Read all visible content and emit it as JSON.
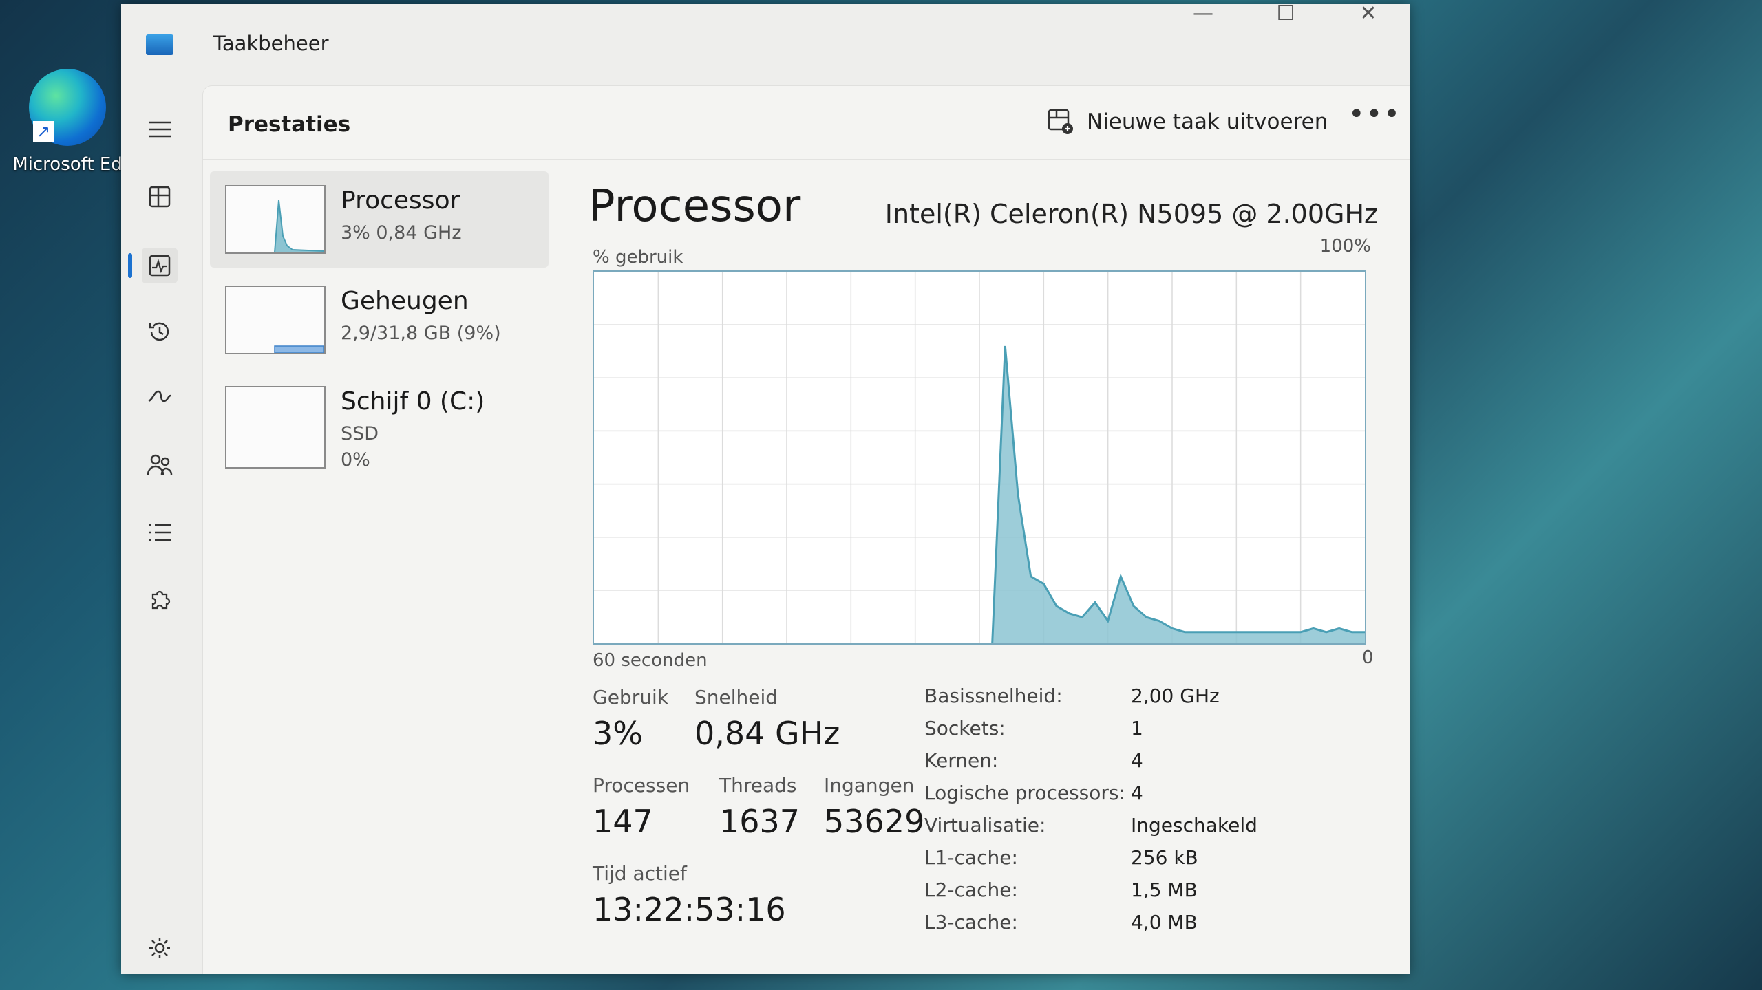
{
  "desktop": {
    "shortcut_label": "Microsoft Ed"
  },
  "window": {
    "title": "Taakbeheer",
    "controls": {
      "minimize": "—",
      "maximize": "☐",
      "close": "✕"
    }
  },
  "header": {
    "title": "Prestaties",
    "new_task_label": "Nieuwe taak uitvoeren",
    "more_label": "•••"
  },
  "sidebar": {
    "items": [
      {
        "name": "Processor",
        "sub": "3% 0,84 GHz"
      },
      {
        "name": "Geheugen",
        "sub": "2,9/31,8 GB (9%)"
      },
      {
        "name": "Schijf 0 (C:)",
        "sub": "SSD",
        "sub2": "0%"
      }
    ]
  },
  "main": {
    "title": "Processor",
    "cpu_model": "Intel(R) Celeron(R) N5095 @ 2.00GHz",
    "usage_axis_label": "% gebruik",
    "axis_max_label": "100%",
    "axis_time_label": "60 seconden",
    "axis_min_label": "0",
    "stats": {
      "usage_label": "Gebruik",
      "usage_value": "3%",
      "speed_label": "Snelheid",
      "speed_value": "0,84 GHz",
      "processes_label": "Processen",
      "processes_value": "147",
      "threads_label": "Threads",
      "threads_value": "1637",
      "handles_label": "Ingangen",
      "handles_value": "53629",
      "uptime_label": "Tijd actief",
      "uptime_value": "13:22:53:16"
    },
    "specs": [
      {
        "k": "Basissnelheid:",
        "v": "2,00 GHz"
      },
      {
        "k": "Sockets:",
        "v": "1"
      },
      {
        "k": "Kernen:",
        "v": "4"
      },
      {
        "k": "Logische processors:",
        "v": "4"
      },
      {
        "k": "Virtualisatie:",
        "v": "Ingeschakeld"
      },
      {
        "k": "L1-cache:",
        "v": "256 kB"
      },
      {
        "k": "L2-cache:",
        "v": "1,5 MB"
      },
      {
        "k": "L3-cache:",
        "v": "4,0 MB"
      }
    ]
  },
  "colors": {
    "accent": "#1c72d0",
    "graph_line": "#4a9fb5",
    "graph_fill": "#8cc4d2",
    "graph_border": "#7aa9bd"
  },
  "chart_data": {
    "type": "area",
    "x_range_seconds": [
      60,
      0
    ],
    "ylim": [
      0,
      100
    ],
    "grid": true,
    "values": [
      0,
      0,
      0,
      0,
      0,
      0,
      0,
      0,
      0,
      0,
      0,
      0,
      0,
      0,
      0,
      0,
      0,
      0,
      0,
      0,
      0,
      0,
      0,
      0,
      0,
      0,
      0,
      0,
      0,
      0,
      0,
      0,
      80,
      40,
      18,
      16,
      10,
      8,
      7,
      11,
      6,
      18,
      10,
      7,
      6,
      4,
      3,
      3,
      3,
      3,
      3,
      3,
      3,
      3,
      3,
      3,
      4,
      3,
      4,
      3,
      3
    ]
  }
}
